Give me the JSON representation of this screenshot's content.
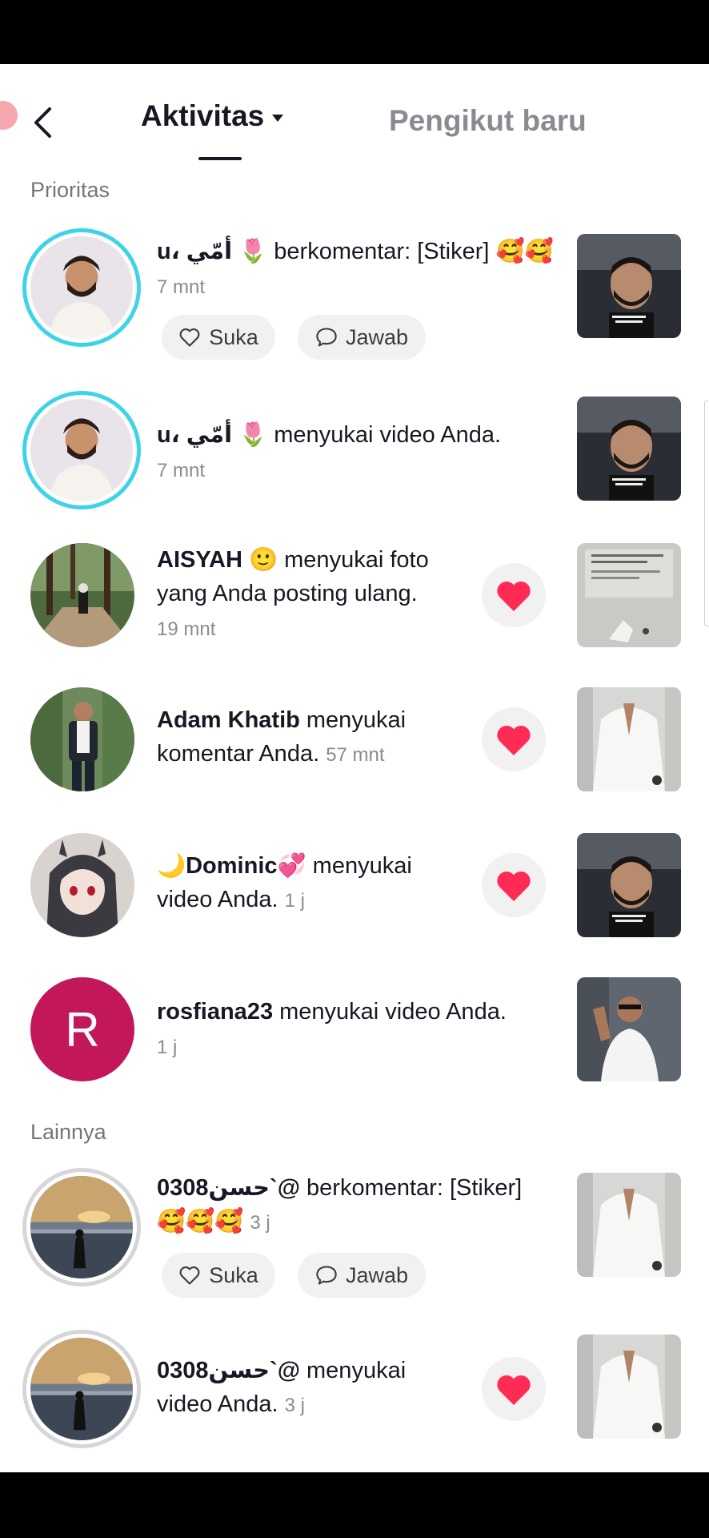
{
  "header": {
    "back_label": "Kembali",
    "tab_active": "Aktivitas",
    "tab_inactive": "Pengikut baru"
  },
  "sections": {
    "priority": "Prioritas",
    "others": "Lainnya"
  },
  "buttons": {
    "like": "Suka",
    "reply": "Jawab"
  },
  "notifications": [
    {
      "name": "u، أمّي",
      "action": " berkomentar: [Stiker] ",
      "time": "7 mnt"
    },
    {
      "name": "u، أمّي",
      "action": " menyukai video Anda.",
      "time": "7 mnt"
    },
    {
      "name": "AISYAH",
      "action_line1": " menyukai foto",
      "action_line2": "yang Anda posting ulang.",
      "time": "19 mnt"
    },
    {
      "name": "Adam Khatib",
      "action_line1": " menyukai",
      "action_line2": "komentar Anda. ",
      "time": "57 mnt"
    },
    {
      "name": "Dominic",
      "action_line1": " menyukai",
      "action_line2": "video Anda. ",
      "time": "1 j"
    },
    {
      "name": "rosfiana23",
      "action": " menyukai video Anda.",
      "time": "1 j",
      "avatar_letter": "R"
    },
    {
      "name": "0308حسن`@",
      "action": " berkomentar: [Stiker]",
      "time": "3 j"
    },
    {
      "name": "0308حسن`@",
      "action_line1": " menyukai",
      "action_line2": "video Anda. ",
      "time": "3 j"
    }
  ],
  "colors": {
    "heart": "#fe2c55",
    "ring_blue": "#3fd3e8",
    "avatar_r": "#c2185b"
  }
}
